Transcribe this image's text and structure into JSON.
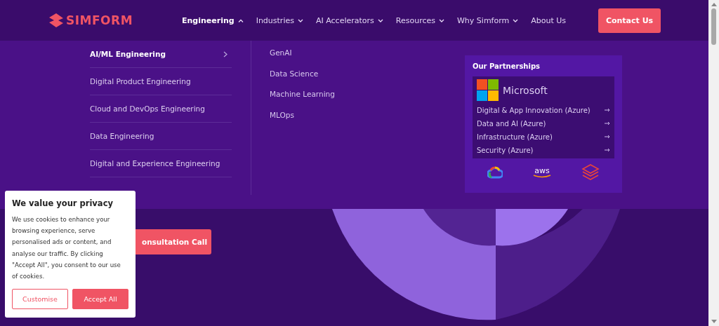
{
  "header": {
    "logo": "SIMFORM",
    "nav": [
      {
        "label": "Engineering",
        "kind": "dropdown",
        "expanded": true
      },
      {
        "label": "Industries",
        "kind": "dropdown",
        "expanded": false
      },
      {
        "label": "AI Accelerators",
        "kind": "dropdown",
        "expanded": false
      },
      {
        "label": "Resources",
        "kind": "dropdown",
        "expanded": false
      },
      {
        "label": "Why Simform",
        "kind": "dropdown",
        "expanded": false
      },
      {
        "label": "About Us",
        "kind": "link"
      }
    ],
    "cta": "Contact Us"
  },
  "mega_menu": {
    "categories": [
      {
        "label": "AI/ML Engineering",
        "selected": true
      },
      {
        "label": "Digital Product Engineering",
        "selected": false
      },
      {
        "label": "Cloud and DevOps Engineering",
        "selected": false
      },
      {
        "label": "Data Engineering",
        "selected": false
      },
      {
        "label": "Digital and Experience Engineering",
        "selected": false
      }
    ],
    "subitems": [
      "GenAI",
      "Data Science",
      "Machine Learning",
      "MLOps"
    ],
    "partnerships": {
      "title": "Our Partnerships",
      "partner": "Microsoft",
      "links": [
        "Digital & App Innovation (Azure)",
        "Data and AI (Azure)",
        "Infrastructure (Azure)",
        "Security (Azure)"
      ],
      "other_logos": [
        "aws"
      ]
    }
  },
  "hero": {
    "button": "onsultation Call"
  },
  "cookie_banner": {
    "title": "We value your privacy",
    "text": "We use cookies to enhance your browsing experience, serve personalised ads or content, and analyse our traffic. By clicking \"Accept All\", you consent to our use of cookies.",
    "buttons": [
      {
        "label": "Customise",
        "kind": "outline"
      },
      {
        "label": "Accept All",
        "kind": "filled"
      }
    ]
  }
}
